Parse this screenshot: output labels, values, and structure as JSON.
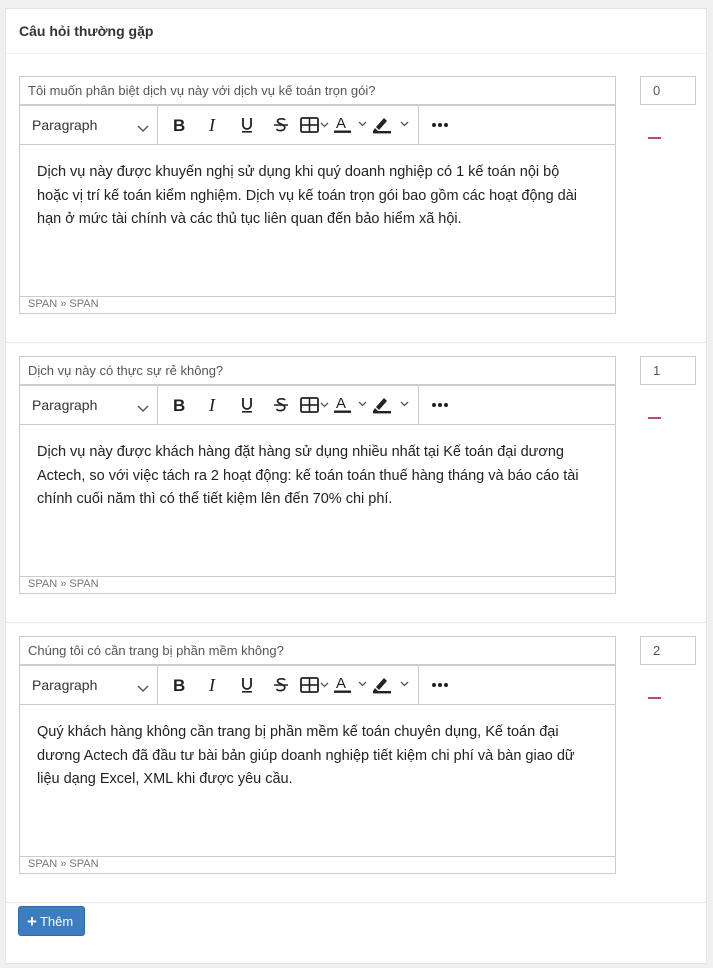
{
  "panel": {
    "title": "Câu hỏi thường gặp"
  },
  "editor_labels": {
    "block_format": "Paragraph",
    "status_path": "SPAN » SPAN"
  },
  "icons": [
    "bold-icon",
    "italic-icon",
    "underline-icon",
    "strikethrough-icon",
    "table-icon",
    "text-color-icon",
    "highlight-icon",
    "more-icon",
    "chevron-down-icon",
    "plus-icon",
    "minus-icon"
  ],
  "colors": {
    "accent_blue": "#3c7cc0",
    "remove_pink": "#c2447f",
    "highlight_bar": "#222222"
  },
  "faqs": [
    {
      "order": "0",
      "question": "Tôi muốn phân biệt dịch vụ này với dịch vụ kế toán trọn gói?",
      "answer_lines": [
        "Dịch vụ này được khuyến nghị sử dụng khi quý doanh nghiệp có 1 kế toán nội bộ",
        "hoặc vị trí kế toán kiểm nghiệm. Dịch vụ kế toán trọn gói bao gồm các hoạt động dài",
        "hạn ở mức tài chính và các thủ tục liên quan đến bảo hiểm xã hội."
      ]
    },
    {
      "order": "1",
      "question": "Dịch vụ này có thực sự rẻ không?",
      "answer_lines": [
        "Dịch vụ này được khách hàng đặt hàng sử dụng nhiều nhất tại Kế toán đại dương",
        "Actech, so với việc tách ra 2 hoạt động: kế toán toán thuế hàng tháng và báo cáo tài",
        "chính cuối năm thì có thể tiết kiệm lên đến 70% chi phí."
      ]
    },
    {
      "order": "2",
      "question": "Chúng tôi có cần trang bị phần mềm không?",
      "answer_lines": [
        "Quý khách hàng không cần trang bị phần mềm kế toán chuyên dụng, Kế toán đại",
        "dương Actech đã đầu tư bài bản giúp doanh nghiệp tiết kiệm chi phí và bàn giao dữ",
        "liệu dạng Excel, XML khi được yêu cầu."
      ]
    }
  ],
  "actions": {
    "add_label": "Thêm"
  }
}
